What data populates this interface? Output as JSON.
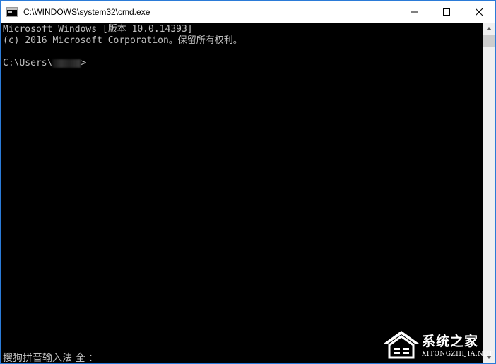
{
  "window": {
    "title": "C:\\WINDOWS\\system32\\cmd.exe",
    "icons": {
      "app": "cmd-app-icon",
      "minimize": "minimize-icon",
      "maximize": "maximize-icon",
      "close": "close-icon"
    }
  },
  "console": {
    "lines": [
      "Microsoft Windows [版本 10.0.14393]",
      "(c) 2016 Microsoft Corporation。保留所有权利。"
    ],
    "prompt_prefix": "C:\\Users\\",
    "prompt_suffix": ">"
  },
  "ime": {
    "status": "搜狗拼音输入法 全 ："
  },
  "watermark": {
    "name": "系统之家",
    "url": "XITONGZHIJIA.NET"
  },
  "colors": {
    "console_bg": "#000000",
    "console_fg": "#c0c0c0",
    "titlebar_bg": "#ffffff",
    "window_border": "#2b7bd8"
  }
}
